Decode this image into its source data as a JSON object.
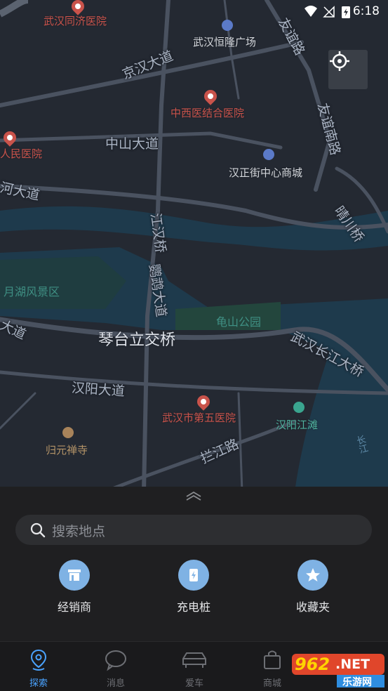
{
  "status_bar": {
    "time": "6:18"
  },
  "map": {
    "roads": {
      "youyi_dadao": "友谊路",
      "jinghan_dadao": "京汉大道",
      "youyi_nanlu": "友谊南路",
      "zhongshan_dadao": "中山大道",
      "he_dadao": "河大道",
      "qingchuan_qiao": "晴川桥",
      "jianghan_qiao": "江汉桥",
      "yingwu_dadao": "鹦鹉大道",
      "dao": "大道",
      "qintai_qiao": "琴台立交桥",
      "changjiang_daqiao": "武汉长江大桥",
      "hanyang_dadao": "汉阳大道",
      "lanjiang_lu": "拦江路",
      "chang": "长江"
    },
    "pois": {
      "tongji": "武汉同济医院",
      "henglong": "武汉恒隆广场",
      "zhongxiyi": "中西医结合医院",
      "renmin": "人民医院",
      "hanzhengjie": "汉正街中心商城",
      "yuehu": "月湖风景区",
      "guishan": "龟山公园",
      "diwu": "武汉市第五医院",
      "hanyang_jiangtan": "汉阳江滩",
      "guiyuan": "归元禅寺"
    }
  },
  "search": {
    "placeholder": "搜索地点",
    "icon": "search-icon"
  },
  "quick_actions": [
    {
      "label": "经销商",
      "icon": "store-icon"
    },
    {
      "label": "充电桩",
      "icon": "charging-icon"
    },
    {
      "label": "收藏夹",
      "icon": "star-icon"
    }
  ],
  "tabs": [
    {
      "label": "探索",
      "icon": "location-icon",
      "active": true
    },
    {
      "label": "消息",
      "icon": "chat-icon"
    },
    {
      "label": "爱车",
      "icon": "car-icon"
    },
    {
      "label": "商城",
      "icon": "bag-icon"
    }
  ],
  "watermark": {
    "number": "962",
    "suffix": ".NET",
    "site": "乐游网"
  },
  "colors": {
    "accent": "#4aa3ff",
    "map_bg": "#242932",
    "water": "#1e3a4c",
    "road": "#4a5260",
    "poi_red": "#c9534b",
    "action_icon_bg": "#7fb2e4"
  }
}
